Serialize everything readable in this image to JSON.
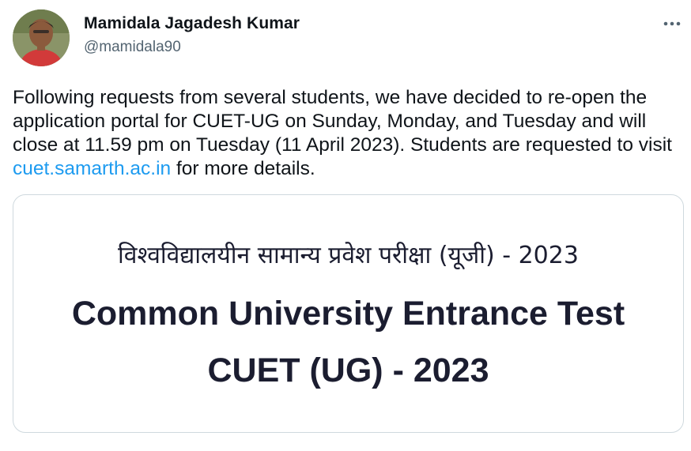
{
  "author": {
    "name": "Mamidala Jagadesh Kumar",
    "handle": "@mamidala90"
  },
  "icons": {
    "more": "more-horizontal-icon",
    "avatar": "profile-photo"
  },
  "tweet": {
    "text_before": "Following requests from several students, we have decided to re-open the application portal for CUET-UG on Sunday, Monday, and Tuesday and will close at 11.59 pm on Tuesday (11 April 2023). Students are requested to visit ",
    "link": "cuet.samarth.ac.in",
    "text_after": " for more details."
  },
  "media": {
    "line_hindi": "विश्वविद्यालयीन सामान्य प्रवेश परीक्षा (यूजी) - 2023",
    "line_english": "Common University Entrance Test",
    "line_code": "CUET (UG) - 2023"
  },
  "colors": {
    "link": "#1d9bf0",
    "text": "#0f1419",
    "handle": "#536471",
    "media_text": "#1b1d30"
  }
}
